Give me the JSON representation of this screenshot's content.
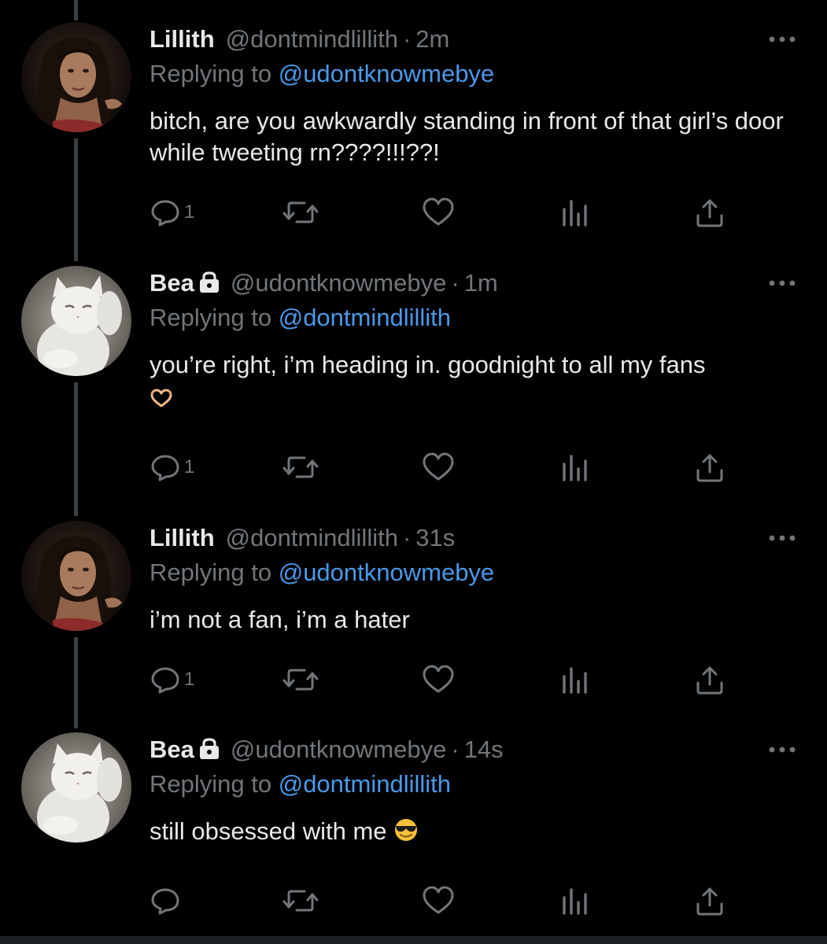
{
  "tweets": [
    {
      "name": "Lillith",
      "handle": "@dontmindlillith",
      "dot": "·",
      "time": "2m",
      "replying_prefix": "Replying to",
      "replying_to": "@udontknowmebye",
      "text": "bitch, are you awkwardly standing in front of that girl’s door while tweeting rn????!!!??!",
      "emoji": "",
      "reply_count": "1",
      "locked": false,
      "avatar_icon": "woman-portrait-avatar"
    },
    {
      "name": "Bea",
      "handle": "@udontknowmebye",
      "dot": "·",
      "time": "1m",
      "replying_prefix": "Replying to",
      "replying_to": "@dontmindlillith",
      "text": "you’re right, i’m heading in. goodnight to all my fans",
      "emoji": "heart-hands-emoji",
      "reply_count": "1",
      "locked": true,
      "avatar_icon": "white-cat-avatar"
    },
    {
      "name": "Lillith",
      "handle": "@dontmindlillith",
      "dot": "·",
      "time": "31s",
      "replying_prefix": "Replying to",
      "replying_to": "@udontknowmebye",
      "text": "i’m not a fan, i’m a hater",
      "emoji": "",
      "reply_count": "1",
      "locked": false,
      "avatar_icon": "woman-portrait-avatar"
    },
    {
      "name": "Bea",
      "handle": "@udontknowmebye",
      "dot": "·",
      "time": "14s",
      "replying_prefix": "Replying to",
      "replying_to": "@dontmindlillith",
      "text": "still obsessed with me",
      "emoji": "sunglasses-emoji",
      "reply_count": "",
      "locked": true,
      "avatar_icon": "white-cat-avatar"
    }
  ],
  "icons": {
    "reply": "reply-icon",
    "retweet": "retweet-icon",
    "like": "heart-icon",
    "views": "views-icon",
    "share": "share-icon",
    "more": "more-icon",
    "lock": "lock-icon"
  },
  "colors": {
    "background": "#000000",
    "text": "#e7e9ea",
    "secondary": "#71767b",
    "mention": "#4a99e9",
    "thread_line": "#3a3f44"
  }
}
